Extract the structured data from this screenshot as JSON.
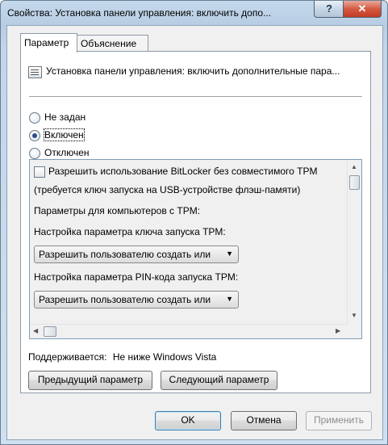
{
  "window": {
    "title": "Свойства: Установка панели управления: включить допо...",
    "help_glyph": "?",
    "close_glyph": "✕"
  },
  "tabs": [
    {
      "label": "Параметр",
      "active": true
    },
    {
      "label": "Объяснение",
      "active": false
    }
  ],
  "policy": {
    "icon": "policy-setting-icon",
    "name": "Установка панели управления: включить дополнительные пара..."
  },
  "state": {
    "options": [
      {
        "label": "Не задан",
        "selected": false
      },
      {
        "label": "Включен",
        "selected": true
      },
      {
        "label": "Отключен",
        "selected": false
      }
    ]
  },
  "options_panel": {
    "allow_without_tpm": {
      "label": "Разрешить использование BitLocker без совместимого TPM",
      "checked": false
    },
    "allow_note": "(требуется ключ запуска на USB-устройстве флэш-памяти)",
    "tpm_section": "Параметры для компьютеров с TPM:",
    "startup_key_label": "Настройка параметра ключа запуска TPM:",
    "startup_key_value": "Разрешить пользователю создать или",
    "startup_pin_label": "Настройка параметра PIN-кода запуска TPM:",
    "startup_pin_value": "Разрешить пользователю создать или",
    "vscroll_position": 0,
    "hscroll_position": 0
  },
  "supported": {
    "label": "Поддерживается:",
    "value": "Не ниже Windows Vista"
  },
  "nav": {
    "previous": "Предыдущий параметр",
    "next": "Следующий параметр"
  },
  "footer": {
    "ok": "OK",
    "cancel": "Отмена",
    "apply": "Применить"
  },
  "colors": {
    "title_gradient": "#c5d9ec",
    "close_button": "#d45a43",
    "dialog_bg": "#f0f0f0",
    "radio_dot": "#2a4f86"
  }
}
